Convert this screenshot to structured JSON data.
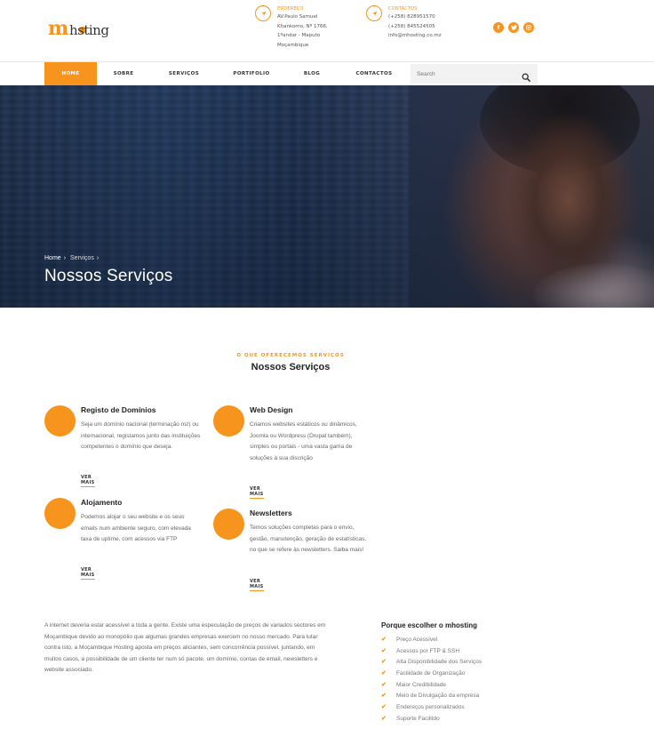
{
  "brand": {
    "logo_m": "m",
    "logo_rest": "hsting",
    "accent": "#f7941d"
  },
  "header": {
    "address": {
      "icon": "navigation-arrow-icon",
      "label": "ENDEREÇO",
      "lines": [
        "AV.Paulo Samuel",
        "Khankomo, Nº 1766,",
        "1ºandar - Maputo",
        "Moçambique"
      ]
    },
    "contacts": {
      "icon": "navigation-arrow-icon",
      "label": "CONTACTOS",
      "lines": [
        "(+258) 828951570",
        "(+258) 845524505",
        "info@mhosting.co.mz"
      ]
    },
    "social": [
      {
        "icon": "facebook-icon",
        "glyph": "f"
      },
      {
        "icon": "twitter-icon",
        "glyph": "t"
      },
      {
        "icon": "instagram-icon",
        "glyph": "◎"
      }
    ]
  },
  "nav": {
    "items": [
      "HOME",
      "SOBRE",
      "SERVIÇOS",
      "PORTIFOLIO",
      "BLOG",
      "CONTACTOS"
    ],
    "active": "HOME",
    "search_placeholder": "Search",
    "search_icon": "search-icon"
  },
  "hero": {
    "breadcrumb": [
      "Home",
      "Serviços"
    ],
    "title": "Nossos Serviços"
  },
  "services": {
    "eyebrow": "O QUE OFERECEMOS SERVIÇOS",
    "title": "Nossos Serviços",
    "more_label": "VER MAIS",
    "items": [
      {
        "title": "Registo de Domínios",
        "desc": "Seja um domínio nacional (terminação mz) ou internacional, registamos junto das instituições competentes o domínio que deseja."
      },
      {
        "title": "Alojamento",
        "desc": "Podemos alojar o seu website e os seus emails num ambiente seguro, com elevada taxa de uptime, com acessos via FTP"
      },
      {
        "title": "Web Design",
        "desc": "Criamos websites estáticos ou dinâmicos, Joomla ou Wordpress (Drupal também), simples ou portais - uma vasta gama de soluções à sua discrição"
      },
      {
        "title": "Newsletters",
        "desc": "Temos soluções completas para o envio, gestão, manutenção, geração de estatísticas, no que se refere às newsletters. Saiba mais!"
      }
    ]
  },
  "about": {
    "text": "A internet deveria estar acessível a toda a gente. Existe uma especulação de preços de variados sectores em Moçambique devido ao monopólio que algumas grandes empresas exercem no nosso mercado. Para lutar contra isto, a Moçambique Hosting aposta em preços aliciantes, sem concorrência possível, juntando, em muitos casos, a possibilidade de um cliente ter num só pacote, um domínio, contas de email, newsletters e website associado."
  },
  "why": {
    "title": "Porque escolher o mhosting",
    "items": [
      "Preço Acessível",
      "Acessos por FTP & SSH",
      "Alta Disponibilidade dos Serviços",
      "Facilidade de Organização",
      "Maior Credibilidade",
      "Meio de Divulgação da empresa",
      "Endereços personalizados",
      "Suporte Facilitdo"
    ]
  }
}
